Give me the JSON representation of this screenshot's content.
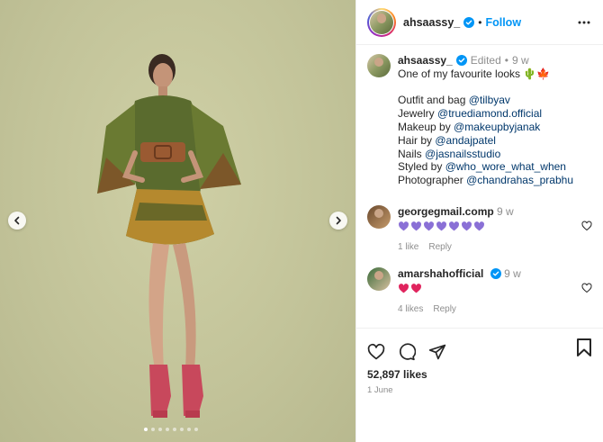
{
  "post": {
    "author": "ahsaassy_",
    "separator": "•",
    "follow_label": "Follow",
    "caption": {
      "username": "ahsaassy_",
      "edited": "Edited",
      "dot": "•",
      "age": "9 w",
      "line1": "One of my favourite looks 🌵🍁",
      "outfit_prefix": "Outfit and bag ",
      "outfit_mention": "@tilbyav",
      "jewelry_prefix": "Jewelry ",
      "jewelry_mention": "@truediamond.official",
      "makeup_prefix": "Makeup by ",
      "makeup_mention": "@makeupbyjanak",
      "hair_prefix": "Hair by ",
      "hair_mention": "@andajpatel",
      "nails_prefix": "Nails ",
      "nails_mention": "@jasnailsstudio",
      "styled_prefix": "Styled by ",
      "styled_mention": "@who_wore_what_when",
      "photo_prefix": "Photographer ",
      "photo_mention": "@chandrahas_prabhu"
    },
    "comments": [
      {
        "username": "georgegmail.comp",
        "age": "9 w",
        "hearts": 7,
        "heart_color": "#8a70d6",
        "likes": "1 like",
        "reply": "Reply"
      },
      {
        "username": "amarshahofficial",
        "age": "9 w",
        "hearts": 2,
        "heart_color": "#e0245e",
        "likes": "4 likes",
        "reply": "Reply"
      }
    ],
    "likes_count": "52,897 likes",
    "date": "1 June",
    "carousel": {
      "count": 8,
      "active_index": 0
    },
    "icons": {
      "prev": "chevron-left-icon",
      "next": "chevron-right-icon",
      "more": "more-horizontal-icon",
      "verified": "verified-badge-icon",
      "like": "heart-outline-icon",
      "comment": "comment-bubble-icon",
      "share": "paper-plane-icon",
      "save": "bookmark-icon"
    },
    "colors": {
      "accent": "#0095f6",
      "verified": "#0095f6",
      "mention": "#00376b",
      "muted": "#8e8e8e"
    }
  }
}
